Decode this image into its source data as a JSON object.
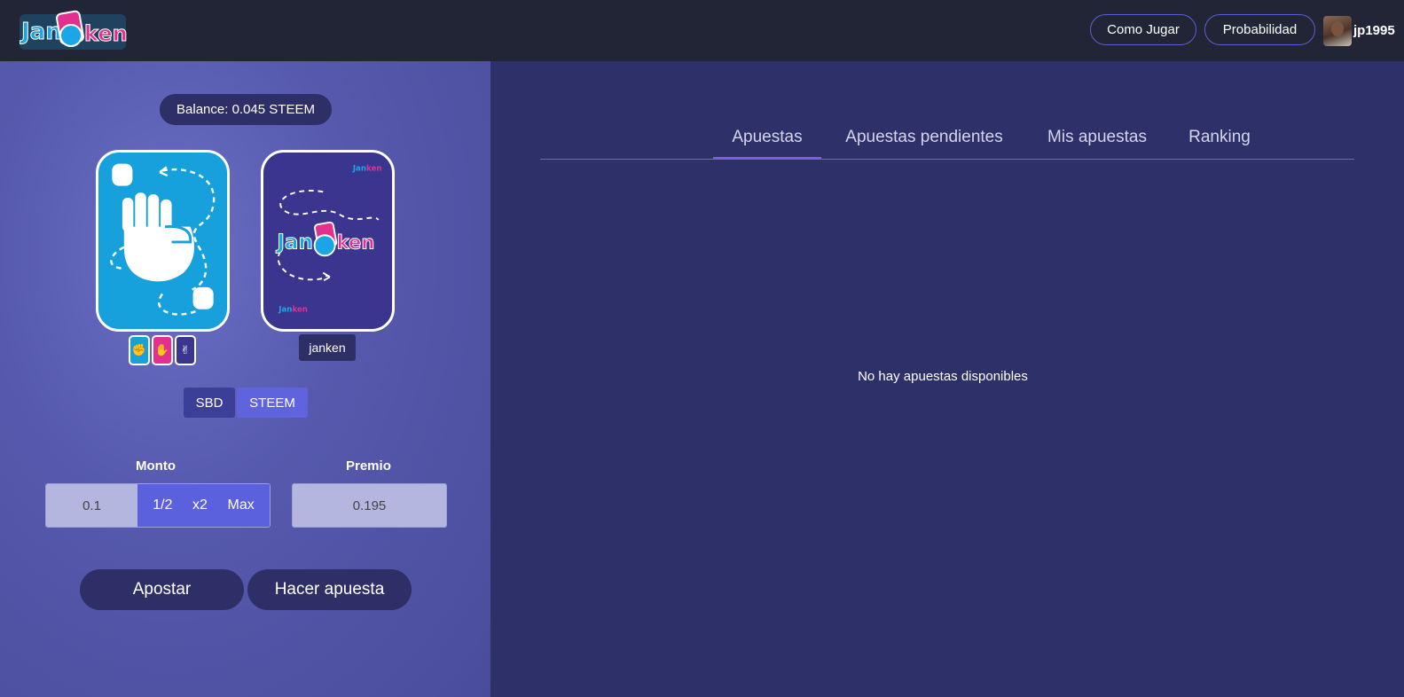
{
  "header": {
    "logo_text": "Janken",
    "nav": [
      {
        "label": "Como Jugar"
      },
      {
        "label": "Probabilidad"
      }
    ],
    "username": "jp1995"
  },
  "left": {
    "balance": "Balance: 0.045 STEEM",
    "opponent_name": "janken",
    "currency": {
      "sbd": "SBD",
      "steem": "STEEM",
      "selected": "STEEM"
    },
    "monto_label": "Monto",
    "monto_value": "0.1",
    "monto_buttons": {
      "half": "1/2",
      "double": "x2",
      "max": "Max"
    },
    "premio_label": "Premio",
    "premio_value": "0.195",
    "actions": {
      "apostar": "Apostar",
      "hacer": "Hacer apuesta"
    }
  },
  "right": {
    "tabs": [
      "Apuestas",
      "Apuestas pendientes",
      "Mis apuestas",
      "Ranking"
    ],
    "active_tab": "Apuestas",
    "empty_message": "No hay apuestas disponibles"
  },
  "colors": {
    "topbar": "#212535",
    "accent": "#5b5fd6",
    "card_rock": "#16a1dd",
    "card_paper": "#e3308f",
    "card_back": "#3a3690"
  }
}
